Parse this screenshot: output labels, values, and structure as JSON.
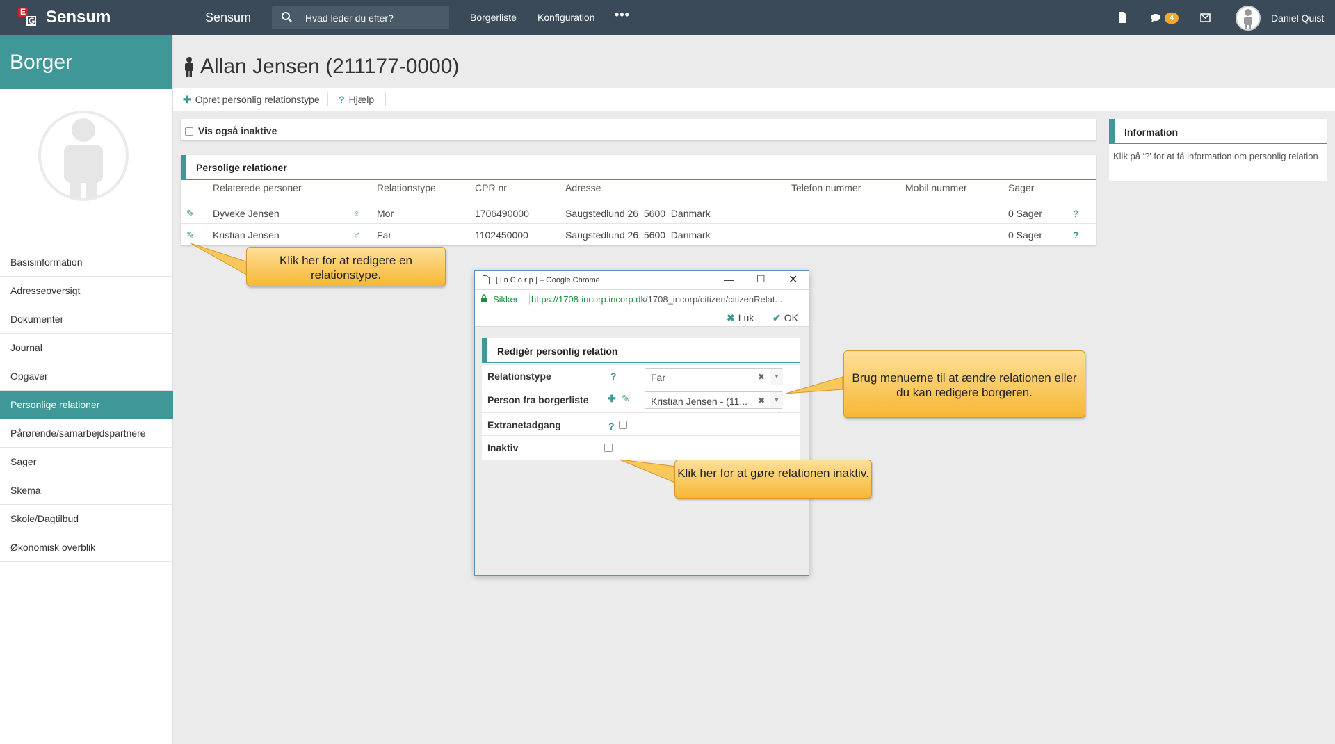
{
  "topbar": {
    "brand": "Sensum",
    "app_name": "Sensum",
    "search_placeholder": "Hvad leder du efter?",
    "nav": [
      "Borgerliste",
      "Konfiguration"
    ],
    "more": "•••",
    "notification_count": "4",
    "username": "Daniel Quist",
    "logo_letters": [
      "E",
      "G"
    ]
  },
  "sidebar": {
    "title": "Borger",
    "items": [
      {
        "label": "Basisinformation"
      },
      {
        "label": "Adresseoversigt"
      },
      {
        "label": "Dokumenter"
      },
      {
        "label": "Journal"
      },
      {
        "label": "Opgaver"
      },
      {
        "label": "Personlige relationer",
        "active": true
      },
      {
        "label": "Pårørende/samarbejdspartnere"
      },
      {
        "label": "Sager"
      },
      {
        "label": "Skema"
      },
      {
        "label": "Skole/Dagtilbud"
      },
      {
        "label": "Økonomisk overblik"
      }
    ]
  },
  "main": {
    "title": "Allan Jensen (211177-0000)",
    "toolbar": {
      "create_label": "Opret personlig relationstype",
      "help_label": "Hjælp"
    },
    "show_inactive_label": "Vis også inaktive",
    "relations_panel_title": "Persolige relationer",
    "columns": [
      "Relaterede personer",
      "Relationstype",
      "CPR nr",
      "Adresse",
      "Telefon nummer",
      "Mobil nummer",
      "Sager"
    ],
    "rows": [
      {
        "name": "Dyveke Jensen",
        "gender_symbol": "♀",
        "type": "Mor",
        "cpr": "1706490000",
        "address": "Saugstedlund 26  5600  Danmark",
        "phone": "",
        "mobile": "",
        "cases": "0 Sager",
        "help": "?"
      },
      {
        "name": "Kristian Jensen",
        "gender_symbol": "♂",
        "type": "Far",
        "cpr": "1102450000",
        "address": "Saugstedlund 26  5600  Danmark",
        "phone": "",
        "mobile": "",
        "cases": "0 Sager",
        "help": "?"
      }
    ]
  },
  "info": {
    "title": "Information",
    "text": "Klik på '?' for at få information om personlig relation"
  },
  "callouts": {
    "edit_type": "Klik her for at redigere en relationstype.",
    "menus": "Brug menuerne til at ændre relationen eller du kan redigere borgeren.",
    "inactive": "Klik her for at gøre relationen inaktiv."
  },
  "popup": {
    "window_title": "[ i n C o r p ] – Google Chrome",
    "secure_label": "Sikker",
    "url_host": "https://1708-incorp.incorp.dk",
    "url_path": "/1708_incorp/citizen/citizenRelat...",
    "close_label": "Luk",
    "ok_label": "OK",
    "panel_title": "Redigér personlig relation",
    "fields": {
      "relation_type_label": "Relationstype",
      "relation_type_value": "Far",
      "person_label": "Person fra borgerliste",
      "person_value": "Kristian Jensen - (11...",
      "extranet_label": "Extranetadgang",
      "inactive_label": "Inaktiv"
    }
  },
  "colors": {
    "accent": "#3f9797",
    "topbar": "#3a4a58",
    "callout": "#f7b733",
    "badge": "#f0a830"
  }
}
